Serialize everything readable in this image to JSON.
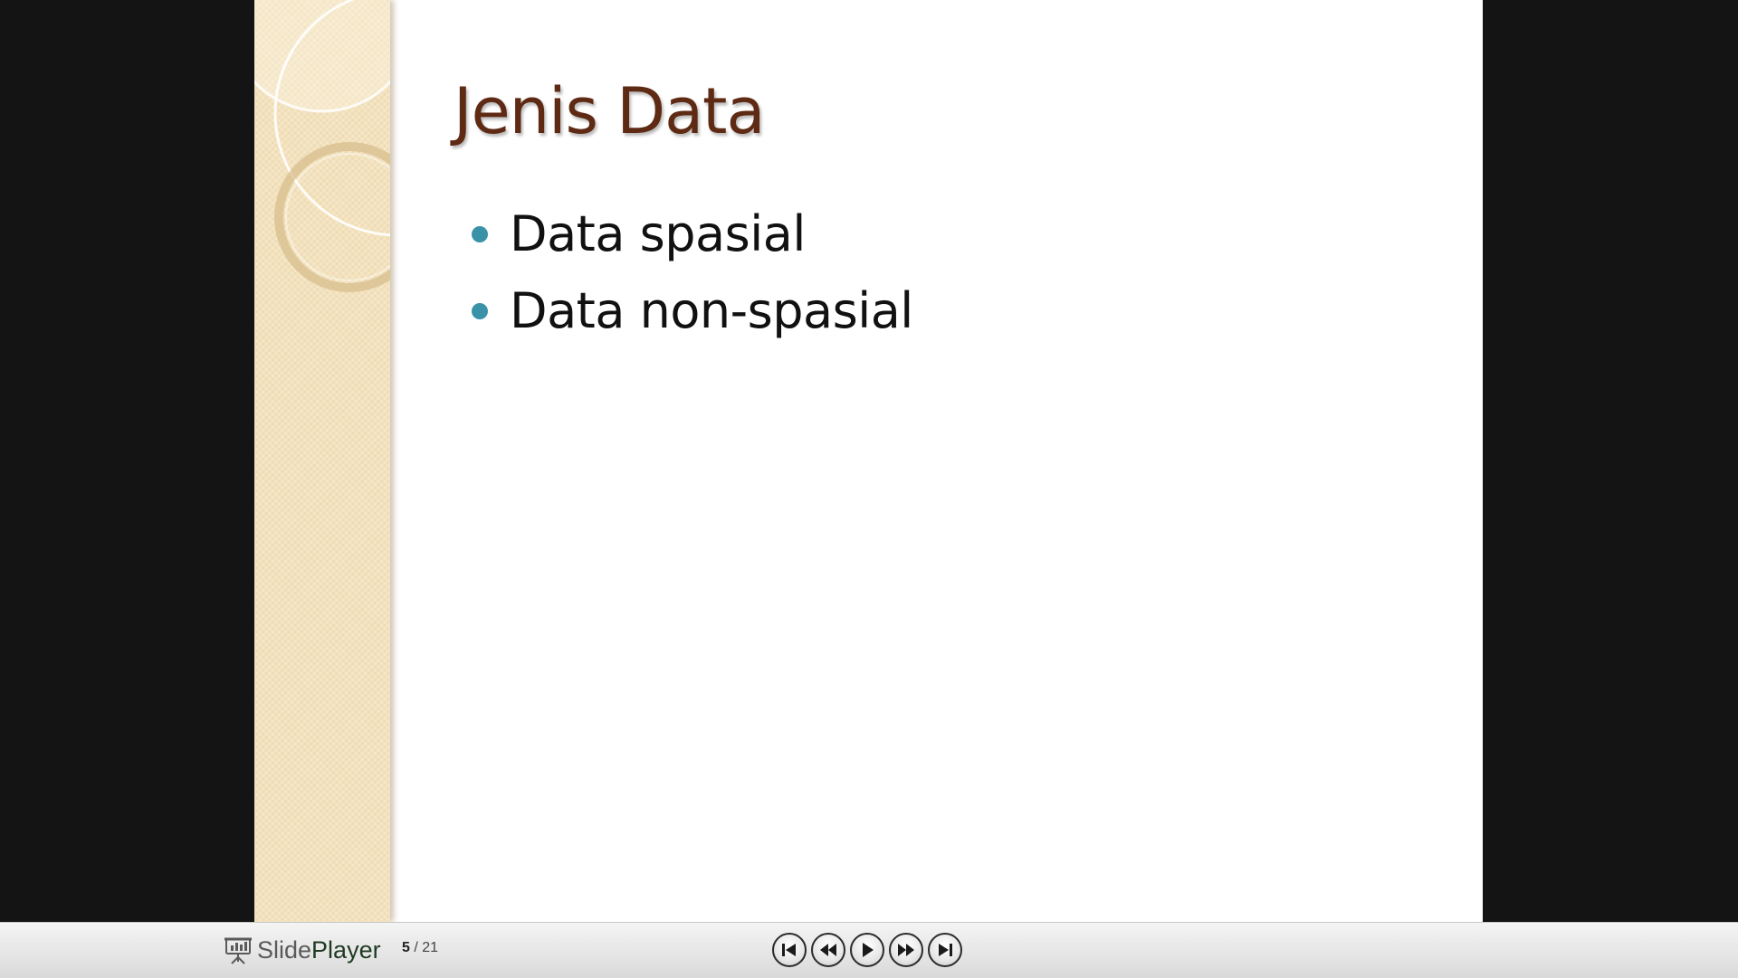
{
  "slide": {
    "title": "Jenis Data",
    "bullets": [
      {
        "text": "Data spasial"
      },
      {
        "text": "Data non-spasial"
      }
    ]
  },
  "player": {
    "brand_prefix": "Slide",
    "brand_suffix": "Player",
    "current_page": "5",
    "separator": "/",
    "total_pages": "21",
    "controls": [
      {
        "name": "first-slide-button",
        "icon": "skip-to-start-icon"
      },
      {
        "name": "previous-slide-button",
        "icon": "rewind-icon"
      },
      {
        "name": "play-button",
        "icon": "play-icon"
      },
      {
        "name": "next-slide-button",
        "icon": "fast-forward-icon"
      },
      {
        "name": "last-slide-button",
        "icon": "skip-to-end-icon"
      }
    ]
  },
  "colors": {
    "background": "#141414",
    "title": "#5e2a14",
    "bullet": "#3a92a8",
    "sidebar": "#f3e2bd"
  }
}
